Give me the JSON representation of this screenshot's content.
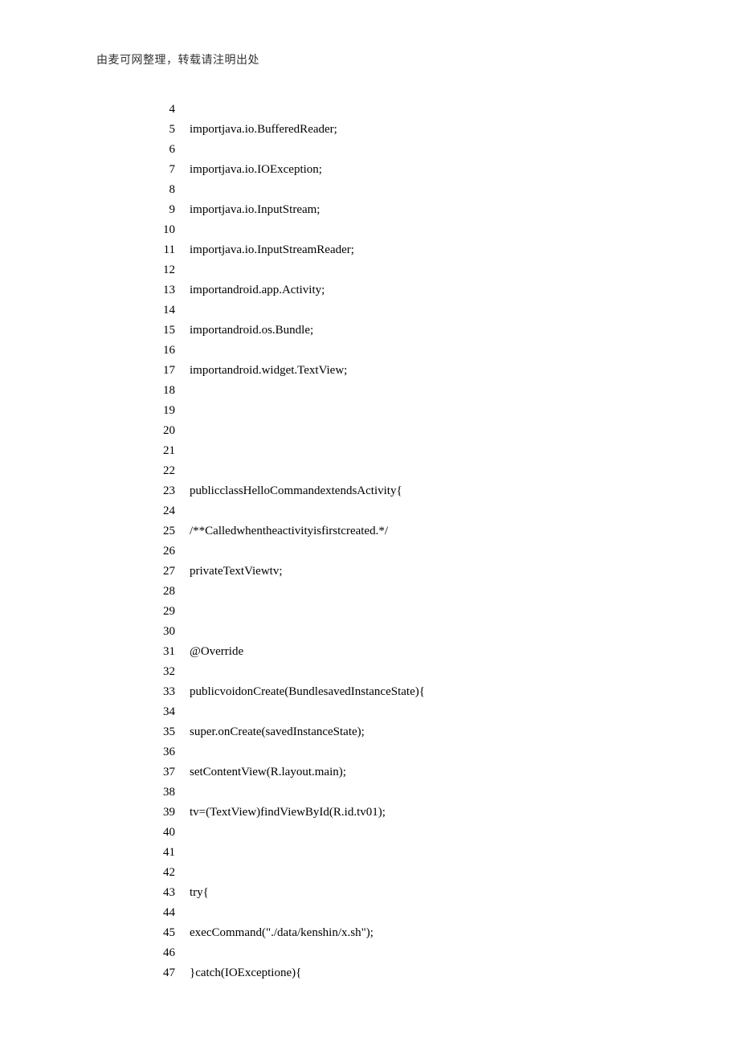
{
  "header": "由麦可网整理，转载请注明出处",
  "lines": [
    {
      "n": "4",
      "c": ""
    },
    {
      "n": "5",
      "c": "importjava.io.BufferedReader;"
    },
    {
      "n": "6",
      "c": ""
    },
    {
      "n": "7",
      "c": "importjava.io.IOException;"
    },
    {
      "n": "8",
      "c": ""
    },
    {
      "n": "9",
      "c": "importjava.io.InputStream;"
    },
    {
      "n": "10",
      "c": ""
    },
    {
      "n": "11",
      "c": "importjava.io.InputStreamReader;"
    },
    {
      "n": "12",
      "c": ""
    },
    {
      "n": "13",
      "c": "importandroid.app.Activity;"
    },
    {
      "n": "14",
      "c": ""
    },
    {
      "n": "15",
      "c": "importandroid.os.Bundle;"
    },
    {
      "n": "16",
      "c": ""
    },
    {
      "n": "17",
      "c": "importandroid.widget.TextView;"
    },
    {
      "n": "18",
      "c": ""
    },
    {
      "n": "19",
      "c": ""
    },
    {
      "n": "20",
      "c": ""
    },
    {
      "n": "21",
      "c": ""
    },
    {
      "n": "22",
      "c": ""
    },
    {
      "n": "23",
      "c": "publicclassHelloCommandextendsActivity{"
    },
    {
      "n": "24",
      "c": ""
    },
    {
      "n": "25",
      "c": "/**Calledwhentheactivityisfirstcreated.*/"
    },
    {
      "n": "26",
      "c": ""
    },
    {
      "n": "27",
      "c": "privateTextViewtv;"
    },
    {
      "n": "28",
      "c": ""
    },
    {
      "n": "29",
      "c": ""
    },
    {
      "n": "30",
      "c": ""
    },
    {
      "n": "31",
      "c": "@Override"
    },
    {
      "n": "32",
      "c": ""
    },
    {
      "n": "33",
      "c": "publicvoidonCreate(BundlesavedInstanceState){"
    },
    {
      "n": "34",
      "c": ""
    },
    {
      "n": "35",
      "c": "super.onCreate(savedInstanceState);"
    },
    {
      "n": "36",
      "c": ""
    },
    {
      "n": "37",
      "c": "setContentView(R.layout.main);"
    },
    {
      "n": "38",
      "c": ""
    },
    {
      "n": "39",
      "c": "tv=(TextView)findViewById(R.id.tv01);"
    },
    {
      "n": "40",
      "c": ""
    },
    {
      "n": "41",
      "c": ""
    },
    {
      "n": "42",
      "c": ""
    },
    {
      "n": "43",
      "c": "try{"
    },
    {
      "n": "44",
      "c": ""
    },
    {
      "n": "45",
      "c": "execCommand(\"./data/kenshin/x.sh\");"
    },
    {
      "n": "46",
      "c": ""
    },
    {
      "n": "47",
      "c": "}catch(IOExceptione){"
    }
  ]
}
